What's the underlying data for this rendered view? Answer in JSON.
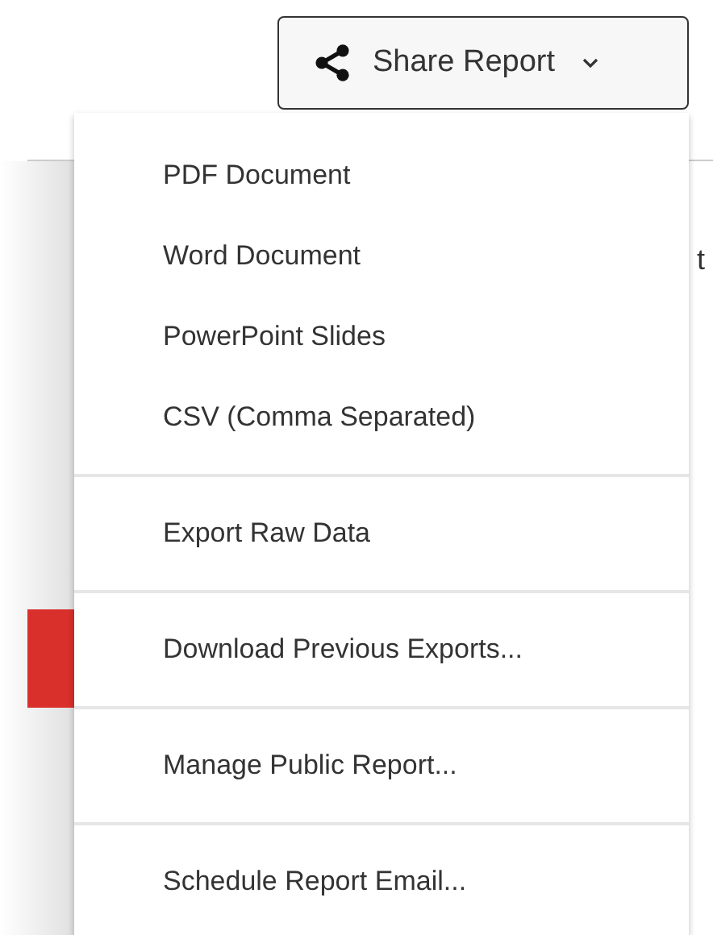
{
  "share_button": {
    "label": "Share Report",
    "expanded": true
  },
  "background_text": "t",
  "menu": {
    "groups": [
      {
        "items": [
          "PDF Document",
          "Word Document",
          "PowerPoint Slides",
          "CSV (Comma Separated)"
        ]
      },
      {
        "items": [
          "Export Raw Data"
        ]
      },
      {
        "items": [
          "Download Previous Exports..."
        ]
      },
      {
        "items": [
          "Manage Public Report..."
        ]
      },
      {
        "items": [
          "Schedule Report Email..."
        ]
      }
    ]
  }
}
